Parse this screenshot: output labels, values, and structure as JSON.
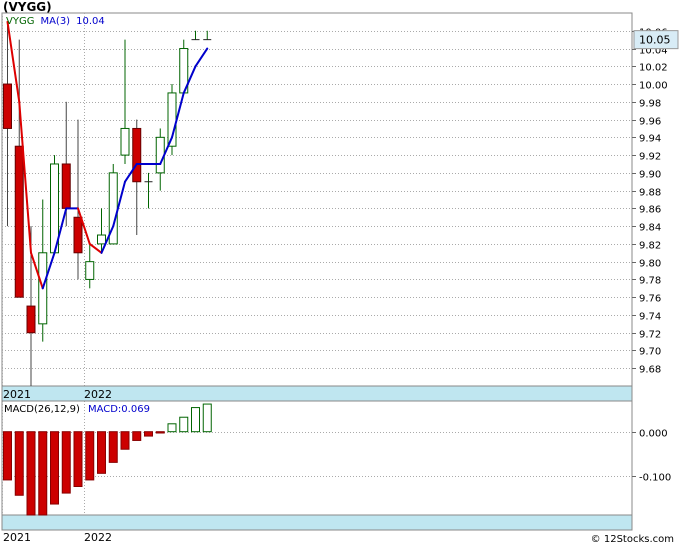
{
  "title": "(VYGG)",
  "watermark": "© 12Stocks.com",
  "colors": {
    "up_candle": "#006400",
    "down_candle": "#cc0000",
    "ma_up": "#0000cc",
    "ma_down": "#dd0000",
    "band": "#bfe6f0",
    "price_badge": "#d8ecf6",
    "legend_ticker": "#006400",
    "legend_ma": "#0000cc"
  },
  "chart_data": [
    {
      "type": "candlestick",
      "legend": {
        "ticker": "VYGG",
        "ma_label": "MA(3)",
        "ma_value": "10.04"
      },
      "ylim": [
        9.66,
        10.08
      ],
      "yticks": [
        "10.06",
        "10.04",
        "10.02",
        "10.00",
        "9.98",
        "9.96",
        "9.94",
        "9.92",
        "9.90",
        "9.88",
        "9.86",
        "9.84",
        "9.82",
        "9.80",
        "9.78",
        "9.76",
        "9.74",
        "9.72",
        "9.70",
        "9.68"
      ],
      "last_price": "10.05",
      "x_labels": [
        {
          "label": "2021",
          "index": 0
        },
        {
          "label": "2022",
          "index": 7
        }
      ],
      "grid": true,
      "candles": [
        {
          "o": 10.0,
          "h": 10.07,
          "l": 9.84,
          "c": 9.95
        },
        {
          "o": 9.93,
          "h": 10.05,
          "l": 9.76,
          "c": 9.76
        },
        {
          "o": 9.75,
          "h": 9.84,
          "l": 9.66,
          "c": 9.72
        },
        {
          "o": 9.73,
          "h": 9.87,
          "l": 9.71,
          "c": 9.81
        },
        {
          "o": 9.81,
          "h": 9.92,
          "l": 9.81,
          "c": 9.91
        },
        {
          "o": 9.91,
          "h": 9.98,
          "l": 9.84,
          "c": 9.86
        },
        {
          "o": 9.85,
          "h": 9.96,
          "l": 9.78,
          "c": 9.81
        },
        {
          "o": 9.78,
          "h": 9.82,
          "l": 9.77,
          "c": 9.8
        },
        {
          "o": 9.82,
          "h": 9.86,
          "l": 9.81,
          "c": 9.83
        },
        {
          "o": 9.82,
          "h": 9.91,
          "l": 9.82,
          "c": 9.9
        },
        {
          "o": 9.92,
          "h": 10.05,
          "l": 9.91,
          "c": 9.95
        },
        {
          "o": 9.95,
          "h": 9.96,
          "l": 9.83,
          "c": 9.89
        },
        {
          "o": 9.89,
          "h": 9.9,
          "l": 9.86,
          "c": 9.89
        },
        {
          "o": 9.9,
          "h": 9.95,
          "l": 9.88,
          "c": 9.94
        },
        {
          "o": 9.93,
          "h": 10.0,
          "l": 9.92,
          "c": 9.99
        },
        {
          "o": 9.99,
          "h": 10.05,
          "l": 9.99,
          "c": 10.04
        },
        {
          "o": 10.05,
          "h": 10.06,
          "l": 10.05,
          "c": 10.05
        },
        {
          "o": 10.05,
          "h": 10.06,
          "l": 10.05,
          "c": 10.05
        }
      ],
      "ma": [
        10.07,
        9.98,
        9.81,
        9.77,
        9.81,
        9.86,
        9.86,
        9.82,
        9.81,
        9.84,
        9.89,
        9.91,
        9.91,
        9.91,
        9.94,
        9.99,
        10.02,
        10.04
      ]
    },
    {
      "type": "bar",
      "legend": {
        "label": "MACD(26,12,9)",
        "value_label": "MACD:0.069"
      },
      "ylim": [
        -0.19,
        0.07
      ],
      "yticks": [
        "0.000",
        "-0.100"
      ],
      "x_labels": [
        {
          "label": "2021",
          "index": 0
        },
        {
          "label": "2022",
          "index": 7
        }
      ],
      "grid": true,
      "values": [
        -0.11,
        -0.145,
        -0.19,
        -0.19,
        -0.165,
        -0.14,
        -0.125,
        -0.11,
        -0.095,
        -0.07,
        -0.04,
        -0.02,
        -0.01,
        -0.003,
        0.018,
        0.033,
        0.055,
        0.063
      ]
    }
  ]
}
